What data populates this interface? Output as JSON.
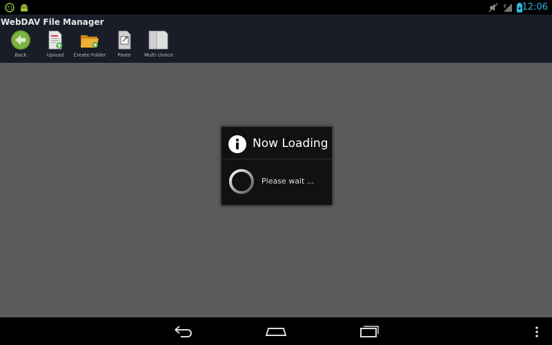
{
  "status_bar": {
    "time": "12:06",
    "network_type": "E",
    "icons": [
      "notification-app-icon",
      "android-debug-icon",
      "mute-icon",
      "signal-icon",
      "battery-charging-icon"
    ]
  },
  "app": {
    "title": "WebDAV File Manager"
  },
  "toolbar": {
    "items": [
      {
        "label": "Back",
        "icon": "back-arrow-icon"
      },
      {
        "label": "Upload",
        "icon": "upload-document-icon"
      },
      {
        "label": "Create Folder",
        "icon": "folder-icon"
      },
      {
        "label": "Paste",
        "icon": "paste-icon"
      },
      {
        "label": "Multi choice",
        "icon": "multi-choice-icon"
      }
    ]
  },
  "dialog": {
    "title": "Now Loading",
    "message": "Please wait ...",
    "icon": "info-icon"
  },
  "nav_bar": {
    "buttons": [
      "nav-back-icon",
      "nav-home-icon",
      "nav-recents-icon",
      "nav-menu-icon"
    ]
  },
  "colors": {
    "accent": "#33b5e5",
    "header_bg": "#191d28",
    "content_bg": "#5b5b5b",
    "dialog_bg": "#111111"
  }
}
